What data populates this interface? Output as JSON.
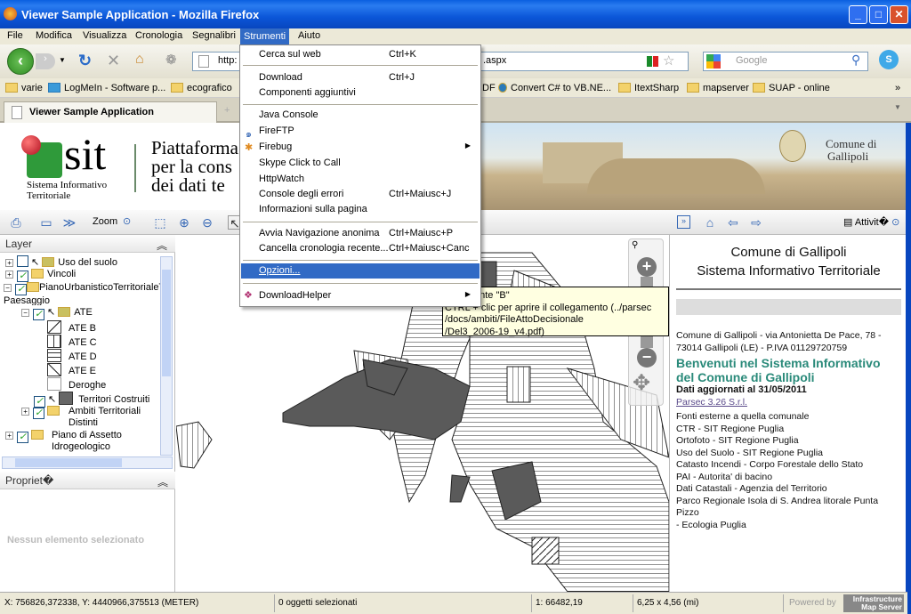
{
  "window": {
    "title": "Viewer Sample Application - Mozilla Firefox",
    "buttons": [
      "_",
      "□",
      "✕"
    ]
  },
  "menubar": [
    "File",
    "Modifica",
    "Visualizza",
    "Cronologia",
    "Segnalibri",
    "Strumenti",
    "Aiuto"
  ],
  "navbar": {
    "url_visible_start": "http:",
    "url_visible_end": ".aspx",
    "search_placeholder": "Google"
  },
  "bookmarks": [
    "varie",
    "LogMeIn - Software p...",
    "ecografico",
    "DF",
    "Convert C# to VB.NE...",
    "ItextSharp",
    "mapserver",
    "SUAP - online",
    "»"
  ],
  "tabs": [
    {
      "label": "Viewer Sample Application"
    }
  ],
  "banner": {
    "logo": "sit",
    "logo_sub1": "Sistema Informativo",
    "logo_sub2": "Territoriale",
    "platform_lines": [
      "Piattaforma",
      "per la cons",
      "dei dati te"
    ],
    "comune": "Comune di",
    "comune2": "Gallipoli"
  },
  "toolbar": {
    "zoom_label": "Zoom",
    "activity_label": "Attivit�"
  },
  "layers": {
    "header": "Layer",
    "items": [
      {
        "label": "Uso del suolo",
        "checked": false,
        "expand": "+"
      },
      {
        "label": "Vincoli",
        "checked": true,
        "expand": "+"
      },
      {
        "label": "PianoUrbanisticoTerritorialeTe",
        "label2": "Paesaggio",
        "checked": true,
        "expand": "-"
      },
      {
        "label": "ATE",
        "checked": true,
        "expand": "-"
      },
      {
        "label": "ATE B"
      },
      {
        "label": "ATE C"
      },
      {
        "label": "ATE D"
      },
      {
        "label": "ATE E"
      },
      {
        "label": "Deroghe"
      },
      {
        "label": "Territori Costruiti",
        "checked": true
      },
      {
        "label": "Ambiti Territoriali",
        "label2": "Distinti",
        "checked": true,
        "expand": "+"
      },
      {
        "label": "Piano di Assetto",
        "label2": "Idrogeologico",
        "checked": true,
        "expand": "+"
      }
    ]
  },
  "properties": {
    "header": "Propriet�",
    "empty": "Nessun elemento selezionato"
  },
  "menu": {
    "items": [
      {
        "label": "Cerca sul web",
        "shortcut": "Ctrl+K"
      },
      {
        "label": "Download",
        "shortcut": "Ctrl+J"
      },
      {
        "label": "Componenti aggiuntivi"
      },
      {
        "label": "Java Console"
      },
      {
        "label": "FireFTP"
      },
      {
        "label": "Firebug",
        "submenu": true
      },
      {
        "label": "Skype Click to Call"
      },
      {
        "label": "HttpWatch"
      },
      {
        "label": "Console degli errori",
        "shortcut": "Ctrl+Maiusc+J"
      },
      {
        "label": "Informazioni sulla pagina"
      },
      {
        "label": "Avvia Navigazione anonima",
        "shortcut": "Ctrl+Maiusc+P"
      },
      {
        "label": "Cancella cronologia recente...",
        "shortcut": "Ctrl+Maiusc+Canc"
      },
      {
        "label": "Opzioni...",
        "selected": true
      },
      {
        "label": "DownloadHelper",
        "submenu": true
      }
    ]
  },
  "tooltip": {
    "lines": [
      "re rilevante \"B\"",
      "CTRL + clic per aprire il collegamento (../parsec",
      "/docs/ambiti/FileAttoDecisionale",
      "/Del3_2006-19_v4.pdf)"
    ]
  },
  "info": {
    "title1": "Comune di Gallipoli",
    "title2": "Sistema Informativo Territoriale",
    "address1": "Comune di Gallipoli - via Antonietta De Pace, 78 -",
    "address2": "73014 Gallipoli (LE) - P.IVA 01129720759",
    "welcome": "Benvenuti nel Sistema Informativo del Comune di Gallipoli",
    "updated": "Dati aggiornati al 31/05/2011",
    "link": "Parsec 3.26 S.r.l.",
    "sources": [
      "Fonti esterne a quella comunale",
      "CTR - SIT Regione Puglia",
      "Ortofoto - SIT Regione Puglia",
      "Uso del Suolo - SIT Regione Puglia",
      "Catasto Incendi - Corpo Forestale dello Stato",
      "PAI - Autorita' di bacino",
      "Dati Catastali - Agenzia del Territorio",
      "Parco Regionale Isola di S. Andrea litorale Punta Pizzo",
      "- Ecologia Puglia"
    ],
    "accent": "#2a8a7a"
  },
  "status": {
    "coords": "X: 756826,372338, Y: 4440966,375513 (METER)",
    "selected": "0 oggetti selezionati",
    "scale": "1: 66482,19",
    "size": "6,25 x 4,56 (mi)",
    "powered": "Powered by",
    "ims1": "Infrastructure",
    "ims2": "Map Server"
  }
}
